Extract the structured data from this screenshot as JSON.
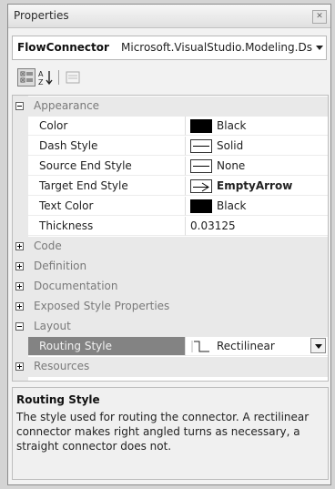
{
  "window": {
    "title": "Properties"
  },
  "selector": {
    "name": "FlowConnector",
    "type": "Microsoft.VisualStudio.Modeling.Ds"
  },
  "grid": {
    "categories": [
      {
        "label": "Appearance",
        "expanded": true,
        "properties": [
          {
            "name": "Color",
            "value": "Black",
            "swatch": "fill",
            "bold": false
          },
          {
            "name": "Dash Style",
            "value": "Solid",
            "swatch": "line",
            "bold": false
          },
          {
            "name": "Source End Style",
            "value": "None",
            "swatch": "line",
            "bold": false
          },
          {
            "name": "Target End Style",
            "value": "EmptyArrow",
            "swatch": "arrow",
            "bold": true
          },
          {
            "name": "Text Color",
            "value": "Black",
            "swatch": "fill",
            "bold": false
          },
          {
            "name": "Thickness",
            "value": "0.03125",
            "swatch": "none",
            "bold": false
          }
        ]
      },
      {
        "label": "Code",
        "expanded": false,
        "properties": []
      },
      {
        "label": "Definition",
        "expanded": false,
        "properties": []
      },
      {
        "label": "Documentation",
        "expanded": false,
        "properties": []
      },
      {
        "label": "Exposed Style Properties",
        "expanded": false,
        "properties": []
      },
      {
        "label": "Layout",
        "expanded": true,
        "properties": [
          {
            "name": "Routing Style",
            "value": "Rectilinear",
            "swatch": "routing",
            "bold": false,
            "selected": true
          }
        ]
      },
      {
        "label": "Resources",
        "expanded": false,
        "properties": []
      }
    ]
  },
  "help": {
    "title": "Routing Style",
    "description": "The style used for routing the connector. A rectilinear connector makes right angled turns as necessary, a straight connector does not."
  },
  "colors": {
    "selected_row": "#838383",
    "category_bg": "#e9e9e9"
  }
}
